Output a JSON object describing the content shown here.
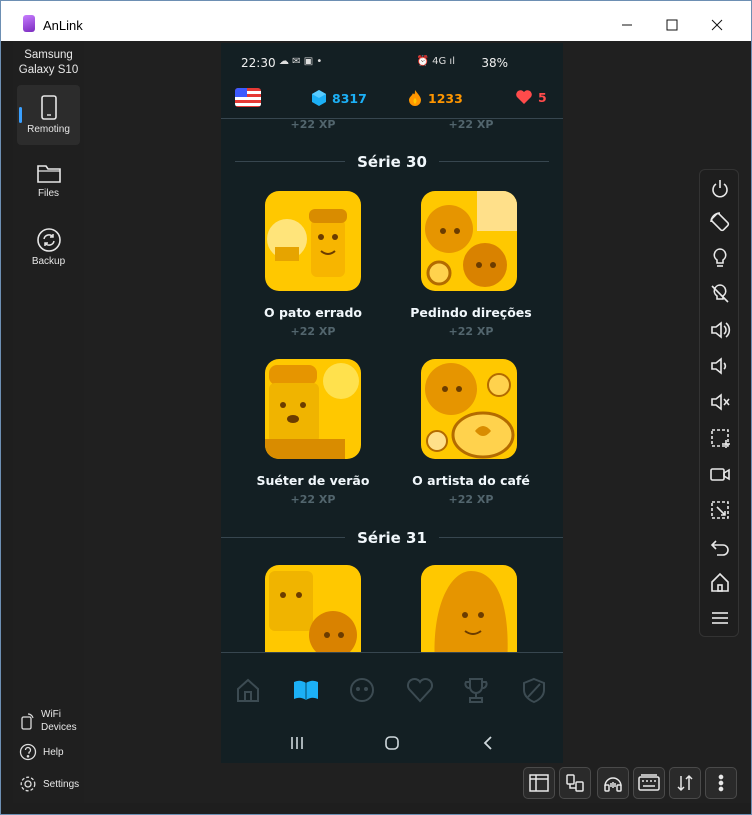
{
  "window": {
    "title": "AnLink"
  },
  "sidebar": {
    "device_name_line1": "Samsung",
    "device_name_line2": "Galaxy S10",
    "items": [
      {
        "label": "Remoting",
        "icon": "phone-icon",
        "active": true
      },
      {
        "label": "Files",
        "icon": "folder-icon"
      },
      {
        "label": "Backup",
        "icon": "backup-icon"
      }
    ],
    "wifi_devices_line1": "WiFi",
    "wifi_devices_line2": "Devices",
    "help": "Help",
    "settings": "Settings"
  },
  "phone": {
    "status": {
      "time": "22:30",
      "battery": "38%",
      "network": "4G"
    },
    "hud": {
      "gems": "8317",
      "streak": "1233",
      "hearts": "5"
    },
    "prev_xp_left": "+22 XP",
    "prev_xp_right": "+22 XP",
    "series30": {
      "title": "Série 30",
      "lessons": [
        {
          "name": "O pato errado",
          "xp": "+22 XP"
        },
        {
          "name": "Pedindo direções",
          "xp": "+22 XP"
        },
        {
          "name": "Suéter de verão",
          "xp": "+22 XP"
        },
        {
          "name": "O artista do café",
          "xp": "+22 XP"
        }
      ]
    },
    "series31": {
      "title": "Série 31"
    }
  },
  "colors": {
    "accent": "#3aa0ff",
    "phone_bg": "#131f23",
    "gem": "#1cb0f6",
    "streak": "#ff9600",
    "heart": "#ff4b4b",
    "lesson_gold": "#ffc800"
  }
}
